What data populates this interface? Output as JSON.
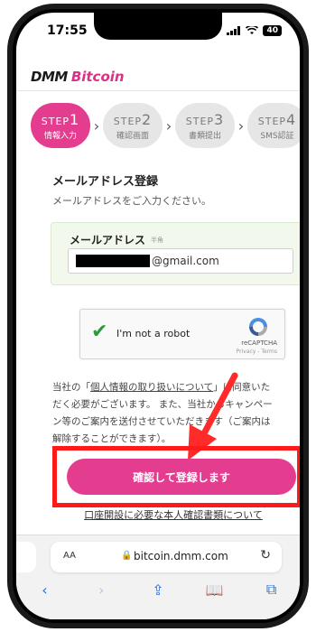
{
  "status_bar": {
    "time": "17:55",
    "battery": "40"
  },
  "header": {
    "logo_dmm": "DMM",
    "logo_bitcoin": "Bitcoin"
  },
  "steps": [
    {
      "label": "STEP",
      "num": "1",
      "sub": "情報入力",
      "active": true
    },
    {
      "label": "STEP",
      "num": "2",
      "sub": "確認画面",
      "active": false
    },
    {
      "label": "STEP",
      "num": "3",
      "sub": "書類提出",
      "active": false
    },
    {
      "label": "STEP",
      "num": "4",
      "sub": "SMS認証",
      "active": false
    }
  ],
  "form": {
    "title": "メールアドレス登録",
    "description": "メールアドレスをご入力ください。",
    "email_label": "メールアドレス",
    "email_hint": "半角",
    "email_value": "@gmail.com"
  },
  "captcha": {
    "text": "I'm not a robot",
    "brand": "reCAPTCHA",
    "links": "Privacy - Terms"
  },
  "notice": {
    "before_link": "当社の「",
    "link": "個人情報の取り扱いについて",
    "after_link": "」に同意いただく必要がございます。 また、当社からキャンペーン等のご案内を送付させていただきます（ご案内は解除することができます）。"
  },
  "cta": {
    "label": "確認して登録します"
  },
  "doc_link": "口座開設に必要な本人確認書類について",
  "browser": {
    "aa": "AA",
    "url": "bitcoin.dmm.com"
  },
  "colors": {
    "accent": "#e43d8f",
    "highlight": "#ff1a1a",
    "ios_blue": "#2b6fd6"
  },
  "icons": [
    "back-icon",
    "forward-icon",
    "share-icon",
    "bookmarks-icon",
    "tabs-icon",
    "reload-icon",
    "lock-icon",
    "checkmark-icon",
    "recaptcha-logo-icon",
    "arrow-annotation-icon"
  ]
}
